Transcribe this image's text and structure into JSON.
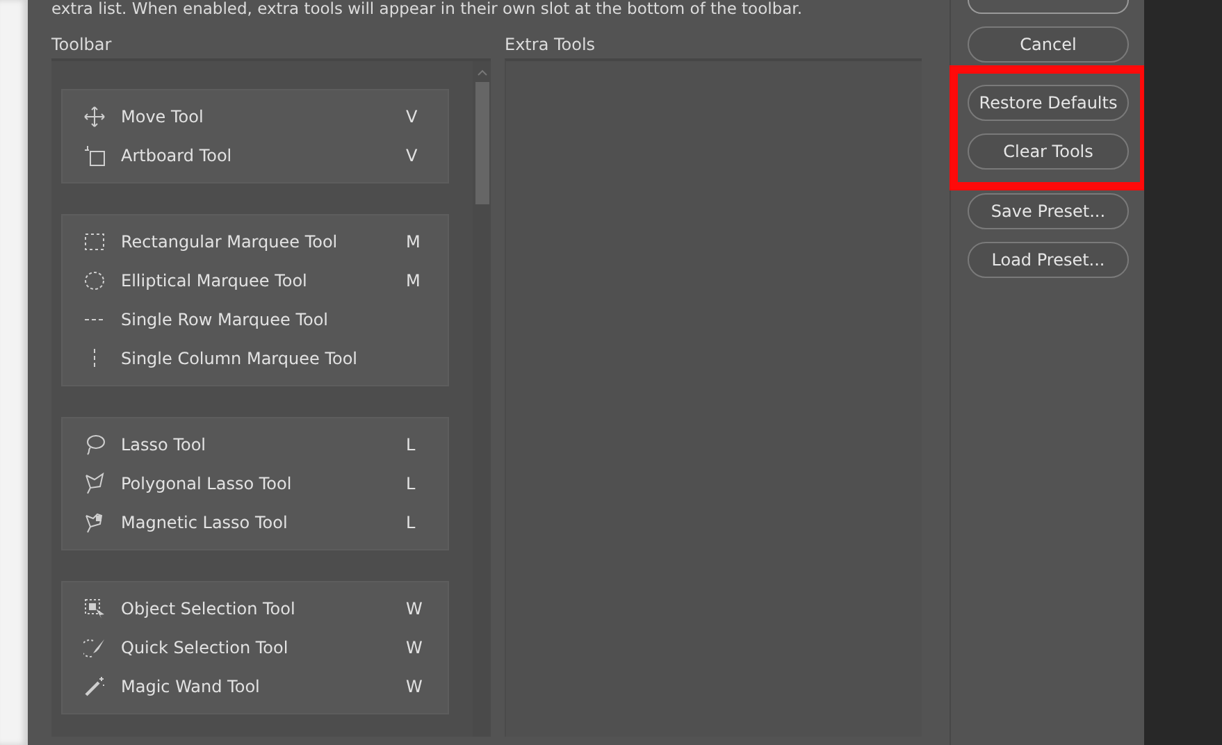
{
  "description": "extra list. When enabled, extra tools will appear in their own slot at the bottom of the toolbar.",
  "toolbar": {
    "label": "Toolbar",
    "groups": [
      {
        "tools": [
          {
            "kind": "move",
            "name": "Move Tool",
            "shortcut": "V"
          },
          {
            "kind": "artboard",
            "name": "Artboard Tool",
            "shortcut": "V"
          }
        ]
      },
      {
        "tools": [
          {
            "kind": "rect-marquee",
            "name": "Rectangular Marquee Tool",
            "shortcut": "M"
          },
          {
            "kind": "ellipse-marquee",
            "name": "Elliptical Marquee Tool",
            "shortcut": "M"
          },
          {
            "kind": "row-marquee",
            "name": "Single Row Marquee Tool"
          },
          {
            "kind": "column-marquee",
            "name": "Single Column Marquee Tool"
          }
        ]
      },
      {
        "tools": [
          {
            "kind": "lasso",
            "name": "Lasso Tool",
            "shortcut": "L"
          },
          {
            "kind": "polygon-lasso",
            "name": "Polygonal Lasso Tool",
            "shortcut": "L"
          },
          {
            "kind": "magnetic-lasso",
            "name": "Magnetic Lasso Tool",
            "shortcut": "L"
          }
        ]
      },
      {
        "tools": [
          {
            "kind": "object-selection",
            "name": "Object Selection Tool",
            "shortcut": "W"
          },
          {
            "kind": "quick-selection",
            "name": "Quick Selection Tool",
            "shortcut": "W"
          },
          {
            "kind": "wand",
            "name": "Magic Wand Tool",
            "shortcut": "W"
          }
        ]
      }
    ]
  },
  "extra_tools": {
    "label": "Extra Tools"
  },
  "buttons": [
    {
      "label": "Cancel",
      "highlighted": false
    },
    {
      "label": "Restore Defaults",
      "highlighted": true
    },
    {
      "label": "Clear Tools",
      "highlighted": true
    },
    {
      "label": "Save Preset...",
      "highlighted": false
    },
    {
      "label": "Load Preset...",
      "highlighted": false
    }
  ]
}
